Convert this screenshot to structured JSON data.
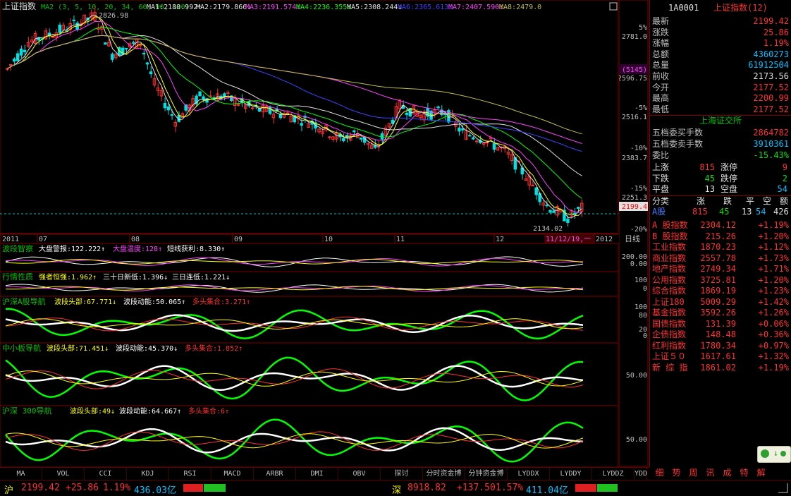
{
  "main_chart": {
    "title": "上证指数",
    "ma_legend": [
      {
        "label": "MA2 (3, 5, 10, 20, 34, 60, 90, 120)",
        "color": "#00c000"
      },
      {
        "label": "MA1:2180.992↑",
        "color": "#e0e0e0"
      },
      {
        "label": "MA2:2179.866↓",
        "color": "#e0e0e0"
      },
      {
        "label": "MA3:2191.574↓",
        "color": "#ff40ff"
      },
      {
        "label": "MA4:2236.355↓",
        "color": "#00ff00"
      },
      {
        "label": "MA5:2308.244↓",
        "color": "#e0e0e0"
      },
      {
        "label": "MA6:2365.613↓",
        "color": "#4040ff"
      },
      {
        "label": "MA7:2407.590↓",
        "color": "#ff40ff"
      },
      {
        "label": "MA8:2479.0",
        "color": "#c0c040"
      }
    ],
    "high_label": "2826.98",
    "low_label": "2134.02",
    "date_marker": "11/12/19,一",
    "months": [
      "2011",
      "07",
      "08",
      "09",
      "10",
      "11",
      "12",
      "2012"
    ],
    "price_axis": [
      "2781.0",
      "2596.75",
      "2516.1",
      "2383.7",
      "2251.3"
    ],
    "pct_axis": [
      "5%",
      "-5%",
      "-10%",
      "-15%",
      "-20%"
    ],
    "pct_zero": "(5145)",
    "current_price_tag": "2199.4",
    "period_label": "日线"
  },
  "sub_panels": [
    {
      "name": "波段智察",
      "items": [
        {
          "t": "大盘警报:122.222↑",
          "c": "#ffffff"
        },
        {
          "t": "大盘温度:128↑",
          "c": "#ff40ff"
        },
        {
          "t": "短线获利:8.330↑",
          "c": "#ffffff"
        }
      ],
      "axis": [
        "200.00",
        "0.00"
      ]
    },
    {
      "name": "行情性质",
      "items": [
        {
          "t": "强者恒强:1.962↑",
          "c": "#ffff00"
        },
        {
          "t": "三十日新低:1.396↓",
          "c": "#ffffff"
        },
        {
          "t": "三日连低:1.221↓",
          "c": "#ffffff"
        }
      ],
      "axis": [
        "100",
        "0"
      ]
    },
    {
      "name": "沪深A股导航",
      "items": [
        {
          "t": "波段头部:67.771↓",
          "c": "#ffff00"
        },
        {
          "t": "波段动能:50.065↑",
          "c": "#ffffff"
        },
        {
          "t": "多头集合:3.271↑",
          "c": "#ff3030"
        }
      ],
      "axis": [
        "100",
        "80",
        "20",
        "0"
      ]
    },
    {
      "name": "中小板导航",
      "items": [
        {
          "t": "波段头部:71.451↓",
          "c": "#ffff00"
        },
        {
          "t": "波段动能:45.370↓",
          "c": "#ffffff"
        },
        {
          "t": "多头集合:1.852↑",
          "c": "#ff3030"
        }
      ],
      "axis": [
        "50.00"
      ]
    },
    {
      "name": "沪深 300导航",
      "items": [
        {
          "t": "波段头部:49↓",
          "c": "#ffff00"
        },
        {
          "t": "波段动能:64.667↑",
          "c": "#ffffff"
        },
        {
          "t": "多头集合:6↑",
          "c": "#ff3030"
        }
      ],
      "axis": [
        "50.00"
      ]
    }
  ],
  "tabs": [
    "MA",
    "VOL",
    "CCI",
    "KDJ",
    "RSI",
    "MACD",
    "ARBR",
    "DMI",
    "OBV",
    "探讨",
    "分时资金博",
    "分钟资金博",
    "LYDDX",
    "LYDDY",
    "LYDDZ",
    "YDD"
  ],
  "panel_tabs": [
    "细",
    "势",
    "周",
    "讯",
    "成",
    "特",
    "解"
  ],
  "quote": {
    "code": "1A0001",
    "name": "上证指数(12)",
    "rows": [
      {
        "label": "最新",
        "value": "2199.42",
        "color": "red"
      },
      {
        "label": "涨跌",
        "value": "25.86",
        "color": "red"
      },
      {
        "label": "涨幅",
        "value": "1.19%",
        "color": "red"
      },
      {
        "label": "总额",
        "value": "4360273",
        "color": "cyan"
      },
      {
        "label": "总量",
        "value": "61912504",
        "color": "cyan"
      },
      {
        "label": "前收",
        "value": "2173.56",
        "color": "white"
      },
      {
        "label": "今开",
        "value": "2177.52",
        "color": "red"
      },
      {
        "label": "最高",
        "value": "2200.99",
        "color": "red"
      },
      {
        "label": "最低",
        "value": "2177.52",
        "color": "red"
      }
    ],
    "exchange": "上海证交所",
    "order_rows": [
      {
        "label": "五档委买手数",
        "value": "2864782",
        "color": "red"
      },
      {
        "label": "五档委卖手数",
        "value": "3910361",
        "color": "cyan"
      },
      {
        "label": "委比",
        "value": "-15.43%",
        "color": "green"
      }
    ],
    "breadth": [
      {
        "l1": "上涨",
        "v1": "815",
        "c1": "red",
        "l2": "涨停",
        "v2": "9",
        "c2": "red"
      },
      {
        "l1": "下跌",
        "v1": "45",
        "c1": "green",
        "l2": "跌停",
        "v2": "2",
        "c2": "green"
      },
      {
        "l1": "平盘",
        "v1": "13",
        "c1": "white",
        "l2": "空盘",
        "v2": "54",
        "c2": "cyan"
      }
    ],
    "cat_header": [
      "分类",
      "涨",
      "跌",
      "平",
      "空",
      "额"
    ],
    "cat_row": {
      "name": "A股",
      "values": [
        "815",
        "45",
        "13",
        "54",
        "426"
      ]
    },
    "indices": [
      {
        "name": "A 股指数",
        "price": "2304.12",
        "chg": "+1.19%"
      },
      {
        "name": "B 股指数",
        "price": "215.26",
        "chg": "+1.20%"
      },
      {
        "name": "工业指数",
        "price": "1870.23",
        "chg": "+1.12%"
      },
      {
        "name": "商业指数",
        "price": "2557.78",
        "chg": "+1.73%"
      },
      {
        "name": "地产指数",
        "price": "2749.34",
        "chg": "+1.71%"
      },
      {
        "name": "公用指数",
        "price": "3725.81",
        "chg": "+1.20%"
      },
      {
        "name": "综合指数",
        "price": "1869.19",
        "chg": "+1.23%"
      },
      {
        "name": "上证180",
        "price": "5009.29",
        "chg": "+1.42%"
      },
      {
        "name": "基金指数",
        "price": "3592.26",
        "chg": "+1.26%"
      },
      {
        "name": "国债指数",
        "price": "131.39",
        "chg": "+0.06%"
      },
      {
        "name": "企债指数",
        "price": "148.48",
        "chg": "+0.36%"
      },
      {
        "name": "红利指数",
        "price": "1780.34",
        "chg": "+0.97%"
      },
      {
        "name": "上证５０",
        "price": "1617.61",
        "chg": "+1.32%"
      },
      {
        "name": "新 综 指",
        "price": "1861.02",
        "chg": "+1.19%"
      }
    ]
  },
  "status": {
    "sh_label": "沪",
    "sh_price": "2199.42",
    "sh_chg": "+25.86",
    "sh_pct": "1.19%",
    "sh_amt": "436.03亿",
    "sz_label": "深",
    "sz_price": "8918.82",
    "sz_chg": "+137.50",
    "sz_pct": "1.57%",
    "sz_amt": "411.04亿"
  },
  "chart_data": {
    "type": "candlestick",
    "title": "上证指数",
    "x": [
      "2011",
      "07",
      "08",
      "09",
      "10",
      "11",
      "12",
      "2012"
    ],
    "price_range_labels": [
      "2781.0",
      "2596.75",
      "2516.1",
      "2383.7",
      "2251.3"
    ],
    "high": 2826.98,
    "low": 2134.02,
    "last": 2199.42,
    "ma_values": [
      2180.992,
      2179.866,
      2191.574,
      2236.355,
      2308.244,
      2365.613,
      2407.59,
      2479.0
    ]
  }
}
